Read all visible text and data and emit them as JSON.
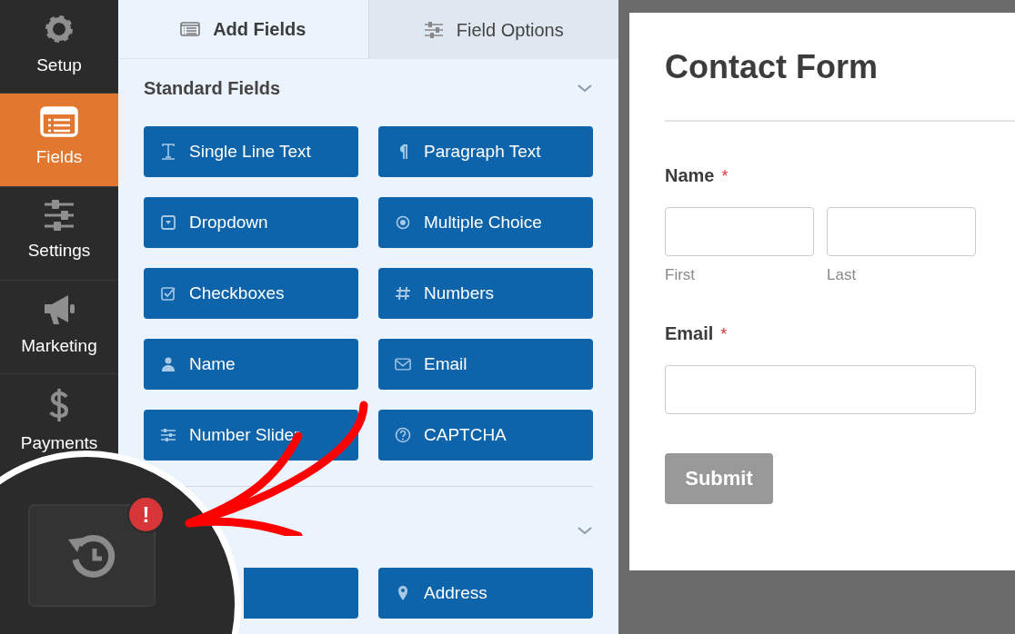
{
  "sidebar": {
    "items": [
      {
        "label": "Setup",
        "selected": false
      },
      {
        "label": "Fields",
        "selected": true
      },
      {
        "label": "Settings",
        "selected": false
      },
      {
        "label": "Marketing",
        "selected": false
      },
      {
        "label": "Payments",
        "selected": false
      }
    ]
  },
  "tabs": [
    {
      "label": "Add Fields",
      "selected": true
    },
    {
      "label": "Field Options",
      "selected": false
    }
  ],
  "sections": [
    {
      "title": "Standard Fields",
      "expanded": true,
      "fields": [
        {
          "label": "Single Line Text",
          "kind": "text"
        },
        {
          "label": "Paragraph Text",
          "kind": "paragraph"
        },
        {
          "label": "Dropdown",
          "kind": "dropdown"
        },
        {
          "label": "Multiple Choice",
          "kind": "radio"
        },
        {
          "label": "Checkboxes",
          "kind": "checkbox"
        },
        {
          "label": "Numbers",
          "kind": "number"
        },
        {
          "label": "Name",
          "kind": "name"
        },
        {
          "label": "Email",
          "kind": "email"
        },
        {
          "label": "Number Slider",
          "kind": "slider"
        },
        {
          "label": "CAPTCHA",
          "kind": "captcha"
        }
      ]
    },
    {
      "expanded": true,
      "fields": [
        {
          "kind": "hidden"
        },
        {
          "label": "Address",
          "kind": "address"
        }
      ]
    }
  ],
  "form": {
    "title": "Contact Form",
    "fields": [
      {
        "kind": "name",
        "label": "Name",
        "required_mark": "*",
        "sublabels": [
          "First",
          "Last"
        ]
      },
      {
        "kind": "email",
        "label": "Email",
        "required_mark": "*"
      }
    ],
    "submit": "Submit"
  },
  "revisions_button": {
    "badge": "!"
  }
}
